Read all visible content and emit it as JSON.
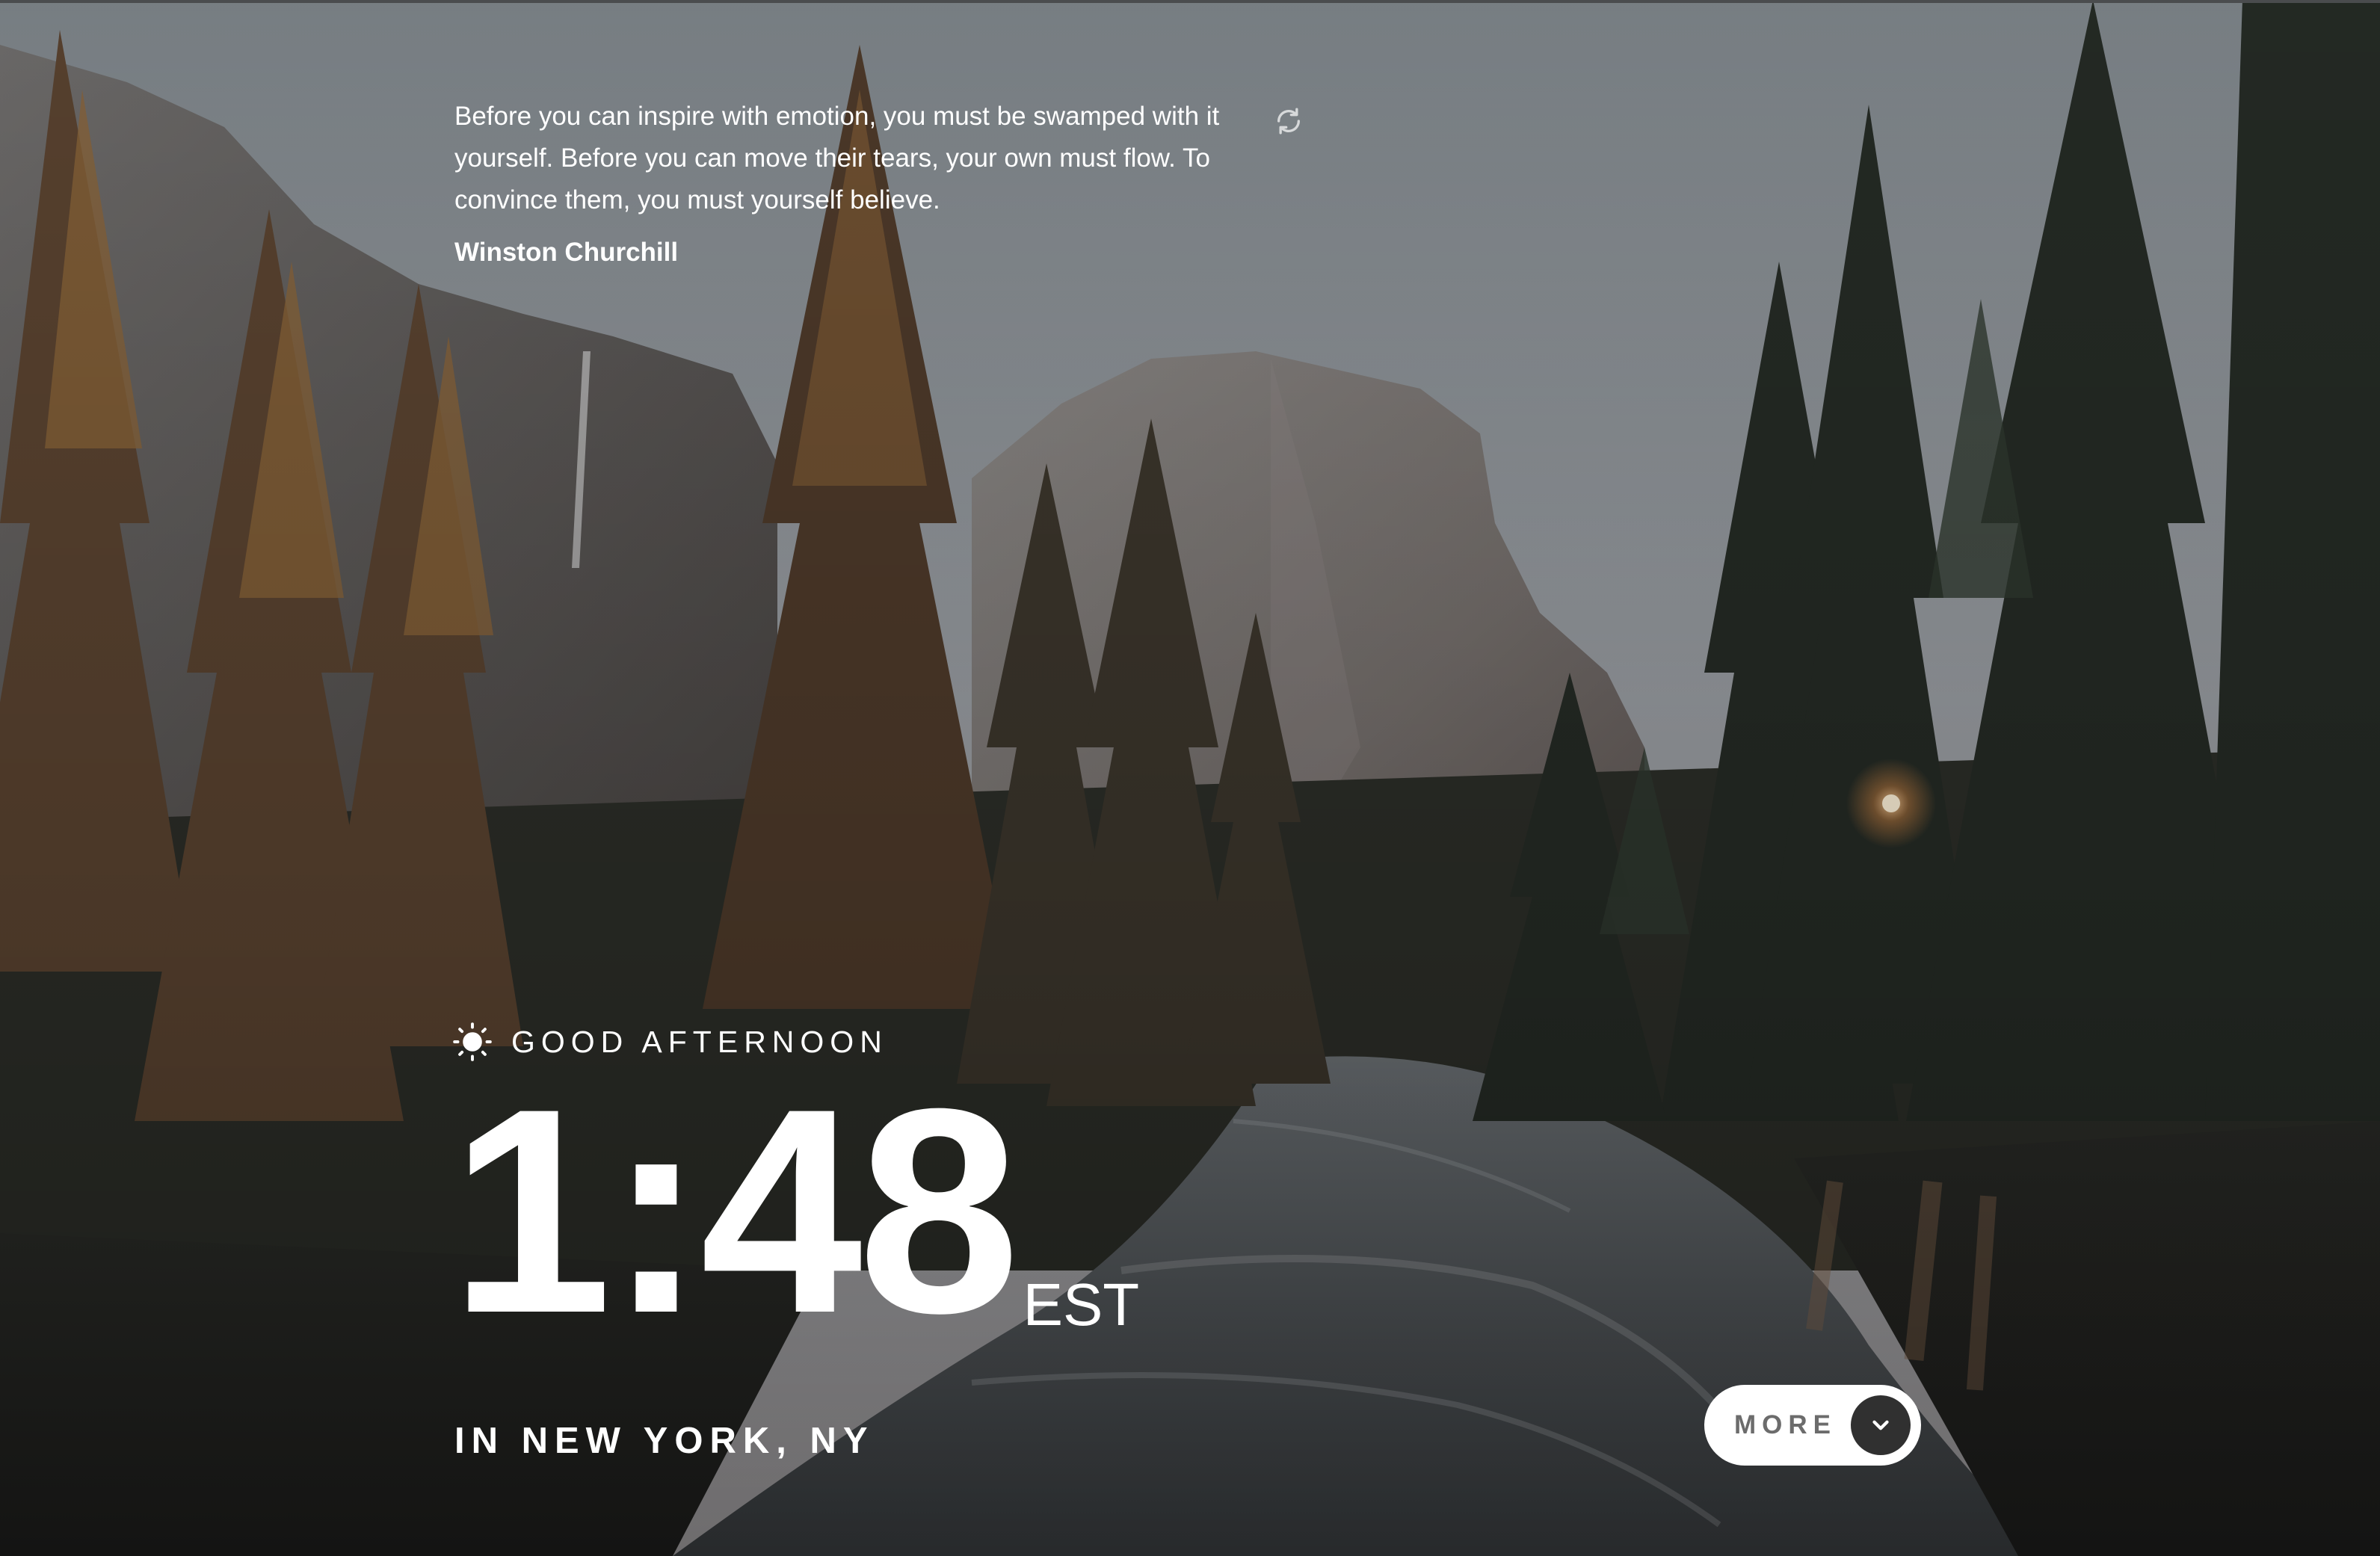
{
  "quote": {
    "text": "Before you can inspire with emotion, you must be swamped with it yourself. Before you can move their tears, your own must flow. To convince them, you must yourself believe.",
    "author": "Winston Churchill",
    "refresh_icon": "refresh-icon"
  },
  "greeting": {
    "icon": "sun-icon",
    "text": "GOOD AFTERNOON"
  },
  "clock": {
    "time": "1:48",
    "timezone": "EST"
  },
  "location": {
    "text": "IN NEW YORK, NY"
  },
  "more_button": {
    "label": "MORE",
    "icon": "chevron-down-icon"
  },
  "colors": {
    "text": "#ffffff",
    "button_bg": "#ffffff",
    "button_label": "#6c6c6c",
    "chevron_bg": "#303030"
  }
}
